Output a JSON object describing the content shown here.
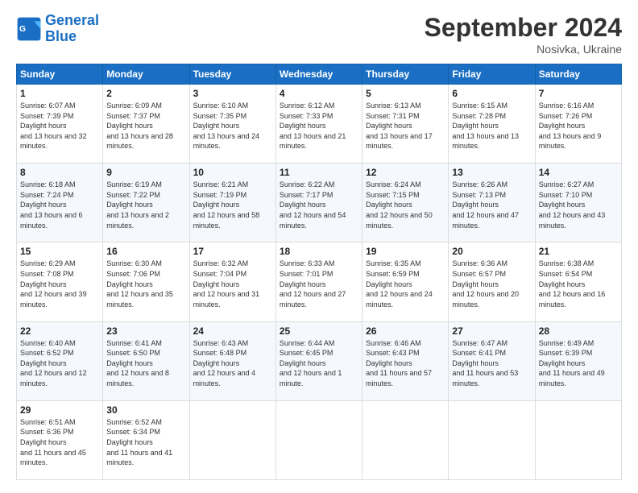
{
  "logo": {
    "line1": "General",
    "line2": "Blue"
  },
  "title": "September 2024",
  "location": "Nosivka, Ukraine",
  "days_header": [
    "Sunday",
    "Monday",
    "Tuesday",
    "Wednesday",
    "Thursday",
    "Friday",
    "Saturday"
  ],
  "weeks": [
    [
      {
        "day": "1",
        "sunrise": "6:07 AM",
        "sunset": "7:39 PM",
        "daylight": "13 hours and 32 minutes."
      },
      {
        "day": "2",
        "sunrise": "6:09 AM",
        "sunset": "7:37 PM",
        "daylight": "13 hours and 28 minutes."
      },
      {
        "day": "3",
        "sunrise": "6:10 AM",
        "sunset": "7:35 PM",
        "daylight": "13 hours and 24 minutes."
      },
      {
        "day": "4",
        "sunrise": "6:12 AM",
        "sunset": "7:33 PM",
        "daylight": "13 hours and 21 minutes."
      },
      {
        "day": "5",
        "sunrise": "6:13 AM",
        "sunset": "7:31 PM",
        "daylight": "13 hours and 17 minutes."
      },
      {
        "day": "6",
        "sunrise": "6:15 AM",
        "sunset": "7:28 PM",
        "daylight": "13 hours and 13 minutes."
      },
      {
        "day": "7",
        "sunrise": "6:16 AM",
        "sunset": "7:26 PM",
        "daylight": "13 hours and 9 minutes."
      }
    ],
    [
      {
        "day": "8",
        "sunrise": "6:18 AM",
        "sunset": "7:24 PM",
        "daylight": "13 hours and 6 minutes."
      },
      {
        "day": "9",
        "sunrise": "6:19 AM",
        "sunset": "7:22 PM",
        "daylight": "13 hours and 2 minutes."
      },
      {
        "day": "10",
        "sunrise": "6:21 AM",
        "sunset": "7:19 PM",
        "daylight": "12 hours and 58 minutes."
      },
      {
        "day": "11",
        "sunrise": "6:22 AM",
        "sunset": "7:17 PM",
        "daylight": "12 hours and 54 minutes."
      },
      {
        "day": "12",
        "sunrise": "6:24 AM",
        "sunset": "7:15 PM",
        "daylight": "12 hours and 50 minutes."
      },
      {
        "day": "13",
        "sunrise": "6:26 AM",
        "sunset": "7:13 PM",
        "daylight": "12 hours and 47 minutes."
      },
      {
        "day": "14",
        "sunrise": "6:27 AM",
        "sunset": "7:10 PM",
        "daylight": "12 hours and 43 minutes."
      }
    ],
    [
      {
        "day": "15",
        "sunrise": "6:29 AM",
        "sunset": "7:08 PM",
        "daylight": "12 hours and 39 minutes."
      },
      {
        "day": "16",
        "sunrise": "6:30 AM",
        "sunset": "7:06 PM",
        "daylight": "12 hours and 35 minutes."
      },
      {
        "day": "17",
        "sunrise": "6:32 AM",
        "sunset": "7:04 PM",
        "daylight": "12 hours and 31 minutes."
      },
      {
        "day": "18",
        "sunrise": "6:33 AM",
        "sunset": "7:01 PM",
        "daylight": "12 hours and 27 minutes."
      },
      {
        "day": "19",
        "sunrise": "6:35 AM",
        "sunset": "6:59 PM",
        "daylight": "12 hours and 24 minutes."
      },
      {
        "day": "20",
        "sunrise": "6:36 AM",
        "sunset": "6:57 PM",
        "daylight": "12 hours and 20 minutes."
      },
      {
        "day": "21",
        "sunrise": "6:38 AM",
        "sunset": "6:54 PM",
        "daylight": "12 hours and 16 minutes."
      }
    ],
    [
      {
        "day": "22",
        "sunrise": "6:40 AM",
        "sunset": "6:52 PM",
        "daylight": "12 hours and 12 minutes."
      },
      {
        "day": "23",
        "sunrise": "6:41 AM",
        "sunset": "6:50 PM",
        "daylight": "12 hours and 8 minutes."
      },
      {
        "day": "24",
        "sunrise": "6:43 AM",
        "sunset": "6:48 PM",
        "daylight": "12 hours and 4 minutes."
      },
      {
        "day": "25",
        "sunrise": "6:44 AM",
        "sunset": "6:45 PM",
        "daylight": "12 hours and 1 minute."
      },
      {
        "day": "26",
        "sunrise": "6:46 AM",
        "sunset": "6:43 PM",
        "daylight": "11 hours and 57 minutes."
      },
      {
        "day": "27",
        "sunrise": "6:47 AM",
        "sunset": "6:41 PM",
        "daylight": "11 hours and 53 minutes."
      },
      {
        "day": "28",
        "sunrise": "6:49 AM",
        "sunset": "6:39 PM",
        "daylight": "11 hours and 49 minutes."
      }
    ],
    [
      {
        "day": "29",
        "sunrise": "6:51 AM",
        "sunset": "6:36 PM",
        "daylight": "11 hours and 45 minutes."
      },
      {
        "day": "30",
        "sunrise": "6:52 AM",
        "sunset": "6:34 PM",
        "daylight": "11 hours and 41 minutes."
      },
      null,
      null,
      null,
      null,
      null
    ]
  ]
}
